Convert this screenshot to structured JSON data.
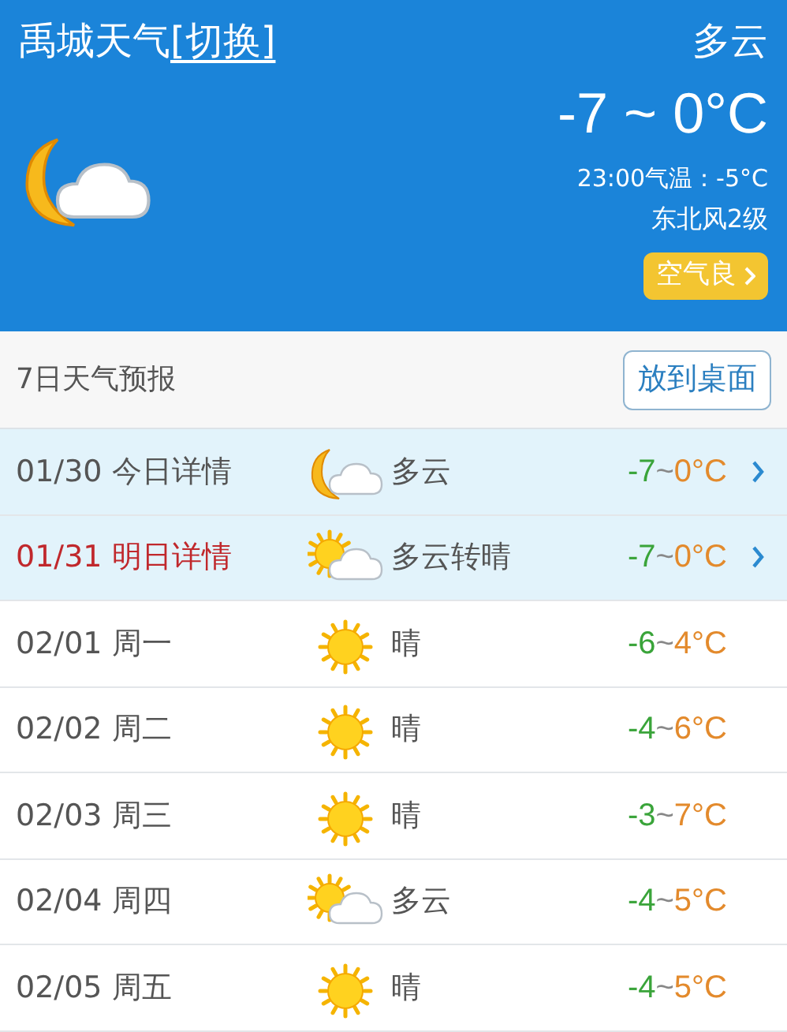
{
  "header": {
    "city_title": "禹城天气",
    "switch_link": "[切换]",
    "kind": "cloudy_night",
    "condition": "多云",
    "temperature": "-7 ~ 0°C",
    "current_temp": "23:00气温：-5°C",
    "wind": "东北风2级",
    "air_quality": "空气良"
  },
  "forecast_section": {
    "title": "7日天气预报",
    "pin_button": "放到桌面"
  },
  "days": [
    {
      "date": "01/30 今日详情",
      "kind": "cloudy_night",
      "condition": "多云",
      "low": "-7",
      "sep": "~",
      "high": "0°C",
      "has_details": true,
      "emphasized": false
    },
    {
      "date": "01/31 明日详情",
      "kind": "partly_sunny",
      "condition": "多云转晴",
      "low": "-7",
      "sep": "~",
      "high": "0°C",
      "has_details": true,
      "emphasized": true
    },
    {
      "date": "02/01 周一",
      "kind": "sunny",
      "condition": "晴",
      "low": "-6",
      "sep": "~",
      "high": "4°C",
      "has_details": false,
      "emphasized": false
    },
    {
      "date": "02/02 周二",
      "kind": "sunny",
      "condition": "晴",
      "low": "-4",
      "sep": "~",
      "high": "6°C",
      "has_details": false,
      "emphasized": false
    },
    {
      "date": "02/03 周三",
      "kind": "sunny",
      "condition": "晴",
      "low": "-3",
      "sep": "~",
      "high": "7°C",
      "has_details": false,
      "emphasized": false
    },
    {
      "date": "02/04 周四",
      "kind": "partly_sunny",
      "condition": "多云",
      "low": "-4",
      "sep": "~",
      "high": "5°C",
      "has_details": false,
      "emphasized": false
    },
    {
      "date": "02/05 周五",
      "kind": "sunny",
      "condition": "晴",
      "low": "-4",
      "sep": "~",
      "high": "5°C",
      "has_details": false,
      "emphasized": false
    }
  ]
}
